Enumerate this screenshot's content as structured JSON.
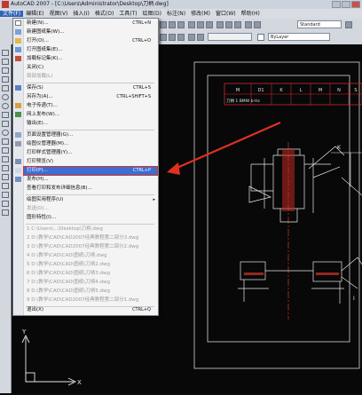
{
  "titlebar": {
    "title": "AutoCAD 2007 - [C:\\Users\\Administrator\\Desktop\\刀柄.dwg]"
  },
  "menubar": {
    "items": [
      "文件(F)",
      "编辑(E)",
      "视图(V)",
      "插入(I)",
      "格式(O)",
      "工具(T)",
      "绘图(D)",
      "标注(N)",
      "修改(M)",
      "窗口(W)",
      "帮助(H)"
    ]
  },
  "toolbar": {
    "style_combo": "Standard",
    "layer_combo": "ByLayer"
  },
  "file_menu": {
    "items": [
      {
        "label": "新建(N)...",
        "shortcut": "CTRL+N"
      },
      {
        "label": "新建图纸集(W)...",
        "shortcut": ""
      },
      {
        "label": "打开(O)...",
        "shortcut": "CTRL+O"
      },
      {
        "label": "打开图纸集(E)...",
        "shortcut": ""
      },
      {
        "label": "加载标记集(K)...",
        "shortcut": ""
      },
      {
        "label": "关闭(C)",
        "shortcut": ""
      },
      {
        "label": "局部加载(L)",
        "shortcut": ""
      },
      {
        "label": "保存(S)",
        "shortcut": "CTRL+S"
      },
      {
        "label": "另存为(A)...",
        "shortcut": "CTRL+SHIFT+S"
      },
      {
        "label": "电子传递(T)...",
        "shortcut": ""
      },
      {
        "label": "网上发布(W)...",
        "shortcut": ""
      },
      {
        "label": "输出(E)...",
        "shortcut": ""
      },
      {
        "label": "页面设置管理器(G)...",
        "shortcut": ""
      },
      {
        "label": "绘图仪管理器(M)...",
        "shortcut": ""
      },
      {
        "label": "打印样式管理器(Y)...",
        "shortcut": ""
      },
      {
        "label": "打印预览(V)",
        "shortcut": ""
      },
      {
        "label": "打印(P)...",
        "shortcut": "CTRL+P"
      },
      {
        "label": "发布(H)...",
        "shortcut": ""
      },
      {
        "label": "查看打印和发布详细信息(B)...",
        "shortcut": ""
      },
      {
        "label": "绘图实用程序(U)",
        "shortcut": ""
      },
      {
        "label": "发送(D)...",
        "shortcut": ""
      },
      {
        "label": "图形特性(I)...",
        "shortcut": ""
      },
      {
        "label": "1 C:\\Users\\...\\Desktop\\刀柄.dwg",
        "shortcut": ""
      },
      {
        "label": "2 D:\\教学\\CAD\\CAD2007经典教程第二部分3.dwg",
        "shortcut": ""
      },
      {
        "label": "3 D:\\教学\\CAD\\CAD2007经典教程第二部分2.dwg",
        "shortcut": ""
      },
      {
        "label": "4 D:\\教学\\CAD\\CAD\\图纸\\刀柄.dwg",
        "shortcut": ""
      },
      {
        "label": "5 D:\\教学\\CAD\\CAD\\图纸\\刀柄2.dwg",
        "shortcut": ""
      },
      {
        "label": "6 D:\\教学\\CAD\\CAD\\图纸\\刀柄3.dwg",
        "shortcut": ""
      },
      {
        "label": "7 D:\\教学\\CAD\\CAD\\图纸\\刀柄4.dwg",
        "shortcut": ""
      },
      {
        "label": "8 D:\\教学\\CAD\\CAD\\图纸\\刀柄5.dwg",
        "shortcut": ""
      },
      {
        "label": "9 D:\\教学\\CAD\\CAD2007经典教程第二部分1.dwg",
        "shortcut": ""
      },
      {
        "label": "退出(X)",
        "shortcut": "CTRL+Q"
      }
    ]
  },
  "drawing": {
    "table_headers": [
      "M",
      "D1",
      "K",
      "L",
      "M",
      "N",
      "S"
    ],
    "table_row": "刀柄 1 BMW b-Hz",
    "label_k": "K",
    "label_i": "I",
    "axis_y": "Y",
    "axis_x": "X"
  },
  "colors": {
    "highlight": "#3b6fd1",
    "annotation_red": "#e03020",
    "drawing_red": "#d0352b",
    "menu_bg": "#f4f4f4"
  }
}
